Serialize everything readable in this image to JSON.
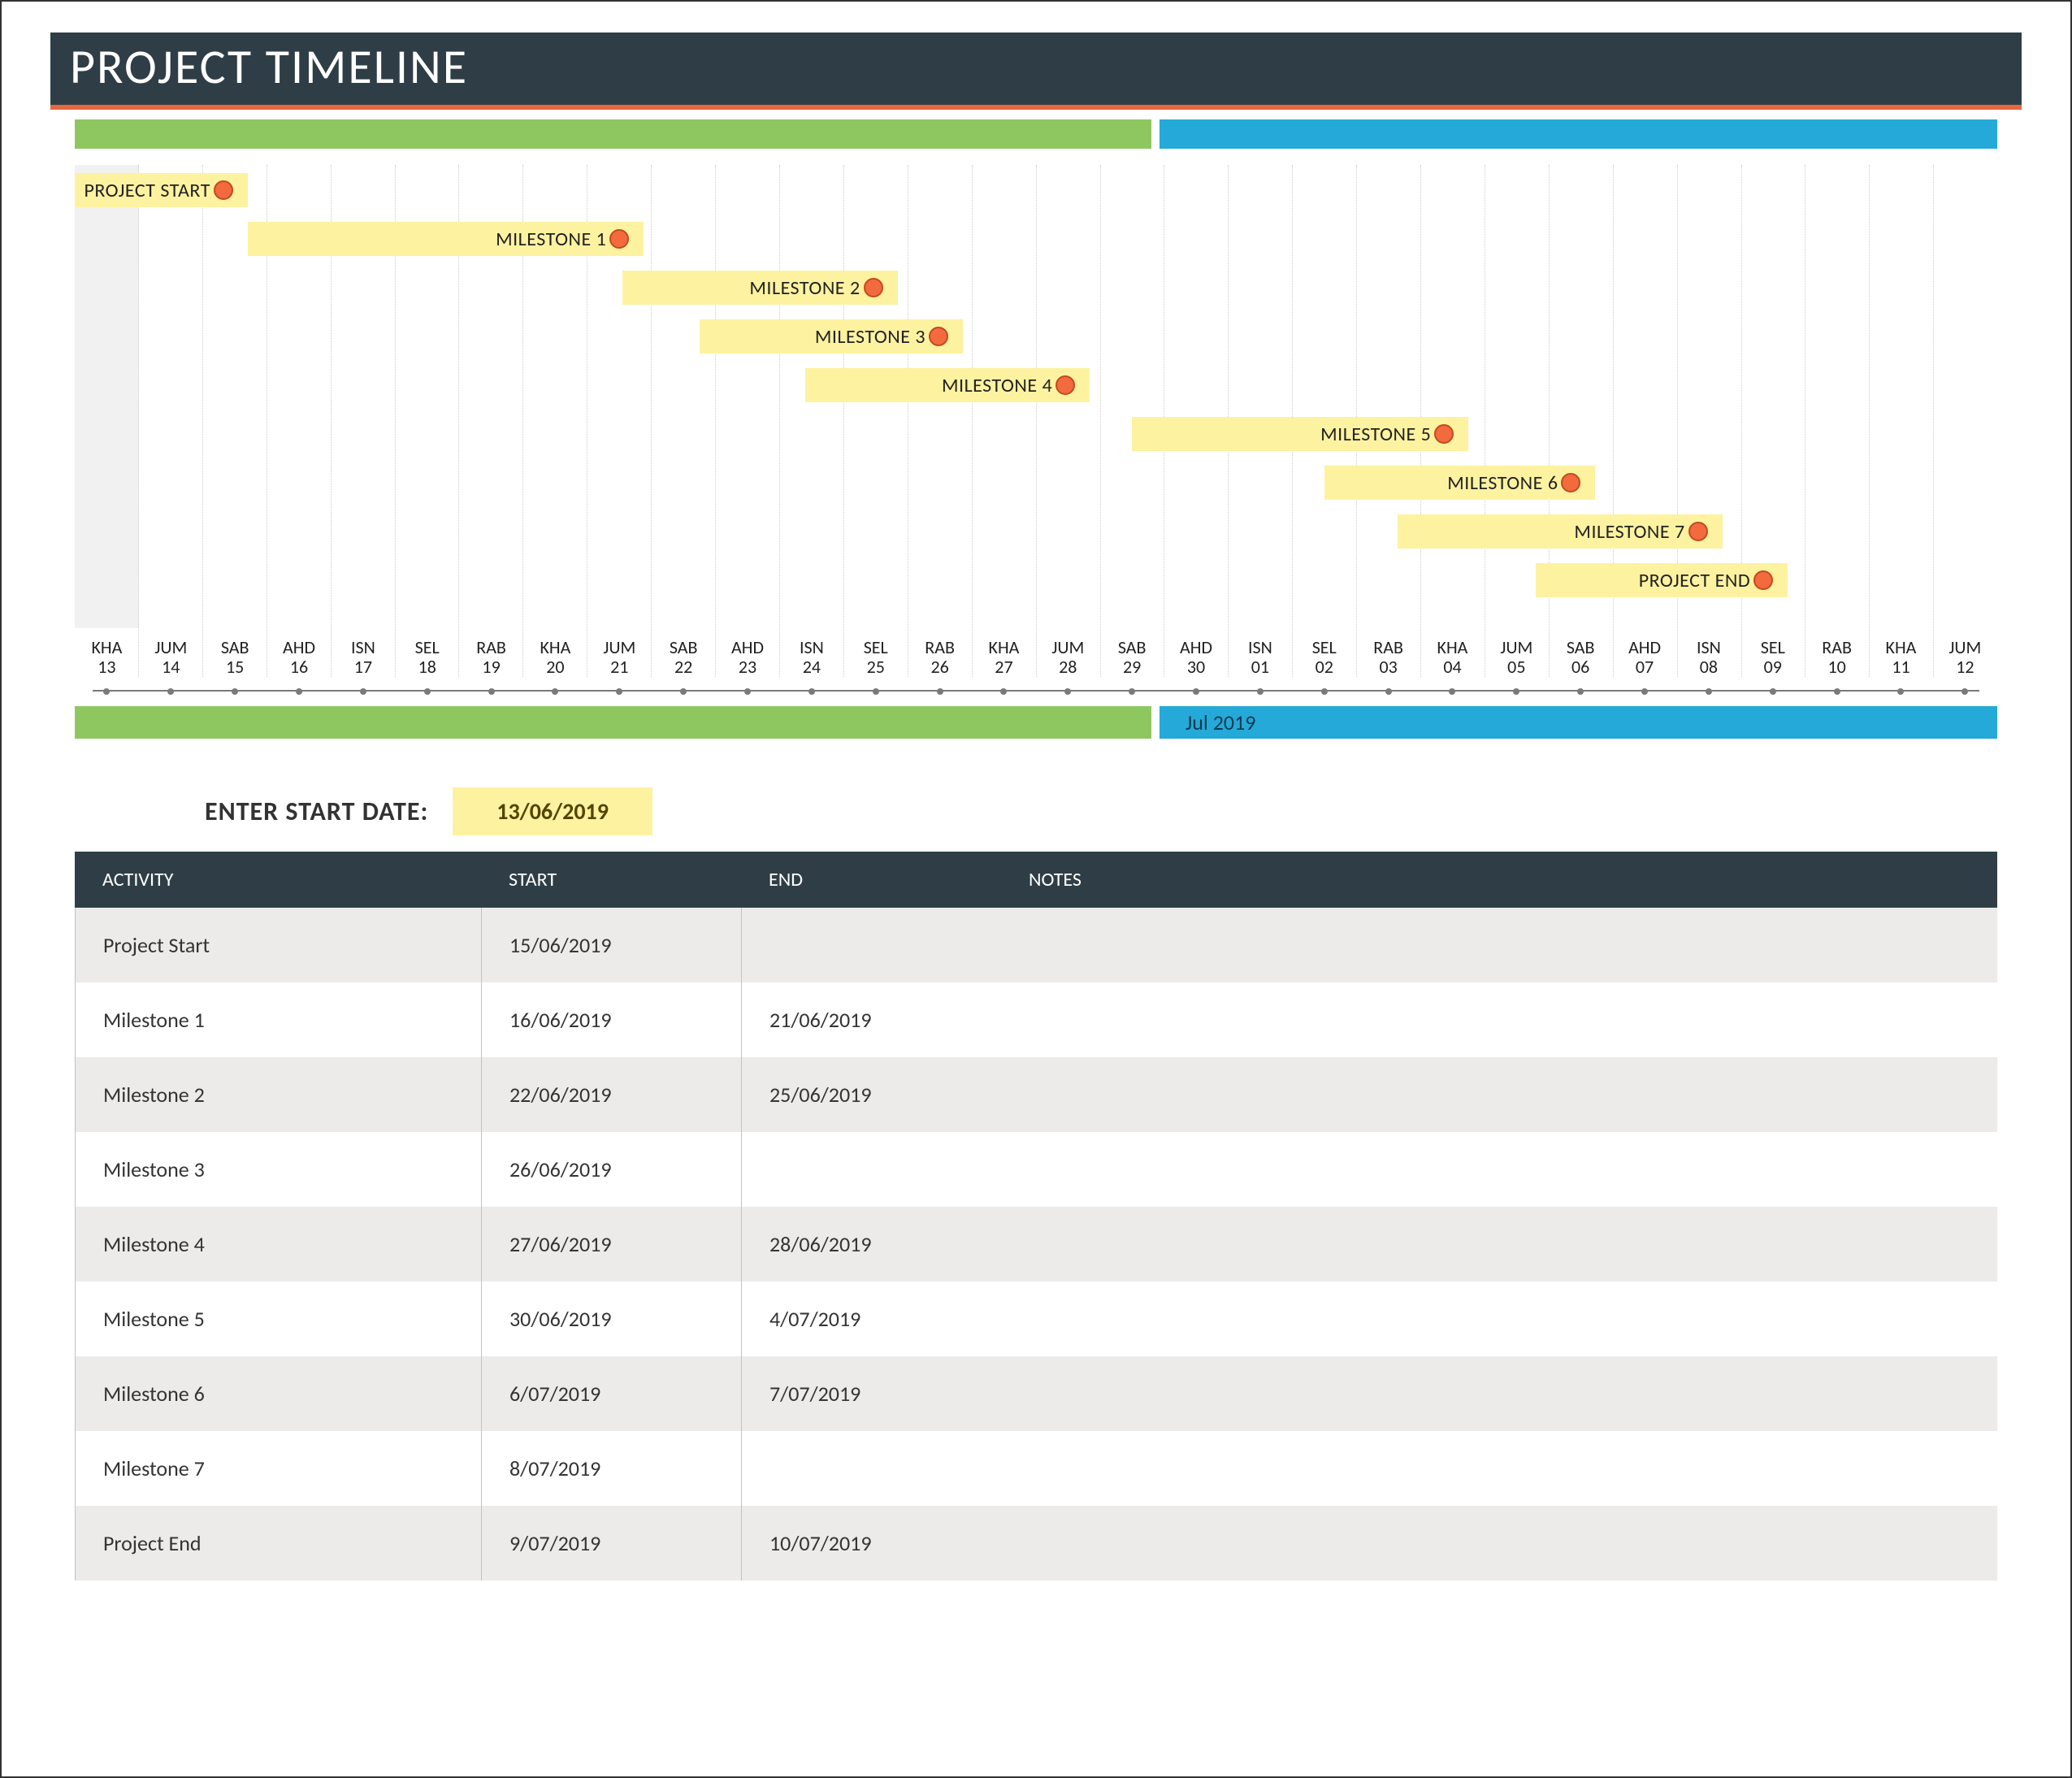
{
  "title": "PROJECT TIMELINE",
  "colors": {
    "green": "#8ec760",
    "blue": "#24a9d8",
    "yellow": "#fdf2a0",
    "orange": "#f36a3e",
    "dark": "#2f3e46",
    "accent": "#e8673f"
  },
  "month_label": "Jul 2019",
  "start_date": {
    "label": "ENTER START DATE:",
    "value": "13/06/2019"
  },
  "axis_ticks": [
    {
      "day": "KHA",
      "num": "13"
    },
    {
      "day": "JUM",
      "num": "14"
    },
    {
      "day": "SAB",
      "num": "15"
    },
    {
      "day": "AHD",
      "num": "16"
    },
    {
      "day": "ISN",
      "num": "17"
    },
    {
      "day": "SEL",
      "num": "18"
    },
    {
      "day": "RAB",
      "num": "19"
    },
    {
      "day": "KHA",
      "num": "20"
    },
    {
      "day": "JUM",
      "num": "21"
    },
    {
      "day": "SAB",
      "num": "22"
    },
    {
      "day": "AHD",
      "num": "23"
    },
    {
      "day": "ISN",
      "num": "24"
    },
    {
      "day": "SEL",
      "num": "25"
    },
    {
      "day": "RAB",
      "num": "26"
    },
    {
      "day": "KHA",
      "num": "27"
    },
    {
      "day": "JUM",
      "num": "28"
    },
    {
      "day": "SAB",
      "num": "29"
    },
    {
      "day": "AHD",
      "num": "30"
    },
    {
      "day": "ISN",
      "num": "01"
    },
    {
      "day": "SEL",
      "num": "02"
    },
    {
      "day": "RAB",
      "num": "03"
    },
    {
      "day": "KHA",
      "num": "04"
    },
    {
      "day": "JUM",
      "num": "05"
    },
    {
      "day": "SAB",
      "num": "06"
    },
    {
      "day": "AHD",
      "num": "07"
    },
    {
      "day": "ISN",
      "num": "08"
    },
    {
      "day": "SEL",
      "num": "09"
    },
    {
      "day": "RAB",
      "num": "10"
    },
    {
      "day": "KHA",
      "num": "11"
    },
    {
      "day": "JUM",
      "num": "12"
    }
  ],
  "milestones": [
    {
      "label": "PROJECT START",
      "start_pct": -0.5,
      "end_pct": 9.0
    },
    {
      "label": "MILESTONE 1",
      "start_pct": 9.0,
      "end_pct": 29.6
    },
    {
      "label": "MILESTONE 2",
      "start_pct": 28.5,
      "end_pct": 42.8
    },
    {
      "label": "MILESTONE 3",
      "start_pct": 32.5,
      "end_pct": 46.2
    },
    {
      "label": "MILESTONE 4",
      "start_pct": 38.0,
      "end_pct": 52.8
    },
    {
      "label": "MILESTONE 5",
      "start_pct": 55.0,
      "end_pct": 72.5
    },
    {
      "label": "MILESTONE 6",
      "start_pct": 65.0,
      "end_pct": 79.1
    },
    {
      "label": "MILESTONE 7",
      "start_pct": 68.8,
      "end_pct": 85.7
    },
    {
      "label": "PROJECT END",
      "start_pct": 76.0,
      "end_pct": 89.1
    }
  ],
  "table": {
    "headers": {
      "activity": "ACTIVITY",
      "start": "START",
      "end": "END",
      "notes": "NOTES"
    },
    "rows": [
      {
        "activity": "Project Start",
        "start": "15/06/2019",
        "end": "",
        "notes": ""
      },
      {
        "activity": "Milestone 1",
        "start": "16/06/2019",
        "end": "21/06/2019",
        "notes": ""
      },
      {
        "activity": "Milestone 2",
        "start": "22/06/2019",
        "end": "25/06/2019",
        "notes": ""
      },
      {
        "activity": "Milestone 3",
        "start": "26/06/2019",
        "end": "",
        "notes": ""
      },
      {
        "activity": "Milestone 4",
        "start": "27/06/2019",
        "end": "28/06/2019",
        "notes": ""
      },
      {
        "activity": "Milestone 5",
        "start": "30/06/2019",
        "end": "4/07/2019",
        "notes": ""
      },
      {
        "activity": "Milestone 6",
        "start": "6/07/2019",
        "end": "7/07/2019",
        "notes": ""
      },
      {
        "activity": "Milestone 7",
        "start": "8/07/2019",
        "end": "",
        "notes": ""
      },
      {
        "activity": "Project End",
        "start": "9/07/2019",
        "end": "10/07/2019",
        "notes": ""
      }
    ]
  },
  "chart_data": {
    "type": "bar",
    "title": "Project Timeline",
    "x": [
      "13/06/2019",
      "12/07/2019"
    ],
    "series": [
      {
        "name": "Project Start",
        "start": "15/06/2019",
        "end": "15/06/2019"
      },
      {
        "name": "Milestone 1",
        "start": "16/06/2019",
        "end": "21/06/2019"
      },
      {
        "name": "Milestone 2",
        "start": "22/06/2019",
        "end": "25/06/2019"
      },
      {
        "name": "Milestone 3",
        "start": "26/06/2019",
        "end": "26/06/2019"
      },
      {
        "name": "Milestone 4",
        "start": "27/06/2019",
        "end": "28/06/2019"
      },
      {
        "name": "Milestone 5",
        "start": "30/06/2019",
        "end": "04/07/2019"
      },
      {
        "name": "Milestone 6",
        "start": "06/07/2019",
        "end": "07/07/2019"
      },
      {
        "name": "Milestone 7",
        "start": "08/07/2019",
        "end": "08/07/2019"
      },
      {
        "name": "Project End",
        "start": "09/07/2019",
        "end": "10/07/2019"
      }
    ]
  }
}
